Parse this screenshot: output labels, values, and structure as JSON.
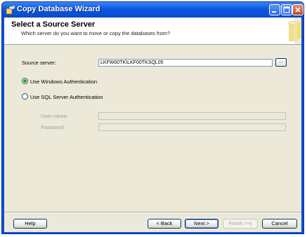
{
  "window": {
    "title": "Copy Database Wizard"
  },
  "header": {
    "title": "Select a Source Server",
    "subtitle": "Which server do you want to move or copy the databases from?"
  },
  "form": {
    "source_server_label": "Source server:",
    "source_server_value": "LKFW00TK\\LKF00TKSQL05",
    "browse_label": "...",
    "windows_auth_label": "Use Windows Authentication",
    "sql_auth_label": "Use SQL Server Authentication",
    "auth_selected": "windows",
    "username_label": "User name:",
    "password_label": "Password:",
    "username_value": "",
    "password_value": ""
  },
  "buttons": {
    "help": "Help",
    "back": "< Back",
    "next": "Next >",
    "finish": "Finish >>|",
    "cancel": "Cancel"
  },
  "colors": {
    "titlebar": "#0a50d8",
    "dialog": "#ece9d8",
    "radio_selected": "#21a121"
  }
}
